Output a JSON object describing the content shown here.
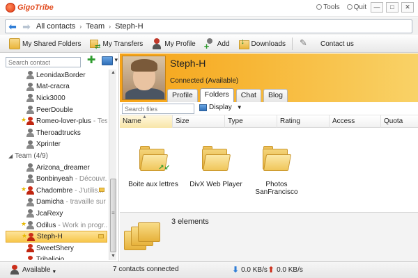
{
  "app": {
    "brand": "GigoTribe"
  },
  "window": {
    "tools_label": "Tools",
    "quit_label": "Quit"
  },
  "breadcrumb": [
    "All contacts",
    "Team",
    "Steph-H"
  ],
  "toolbar": {
    "buttons": [
      {
        "label": "My Shared Folders",
        "icon": "shared-folders-icon"
      },
      {
        "label": "My Transfers",
        "icon": "transfers-icon"
      },
      {
        "label": "My Profile",
        "icon": "profile-icon"
      },
      {
        "label": "Add",
        "icon": "add-contact-icon"
      },
      {
        "label": "Downloads",
        "icon": "downloads-icon"
      },
      {
        "label": "Contact us",
        "icon": "contact-us-icon"
      }
    ]
  },
  "sidebar": {
    "search_placeholder": "Search contact",
    "contacts_top": [
      {
        "name": "LeonidaxBorder",
        "status": "",
        "online": false,
        "star": false,
        "mail": false
      },
      {
        "name": "Mat-cracra",
        "status": "",
        "online": false,
        "star": false,
        "mail": false
      },
      {
        "name": "Nick3000",
        "status": "",
        "online": false,
        "star": false,
        "mail": false
      },
      {
        "name": "PeerDouble",
        "status": "",
        "online": false,
        "star": false,
        "mail": false
      },
      {
        "name": "Romeo-lover-plus",
        "status": "- Tes...",
        "online": true,
        "star": true,
        "mail": false
      },
      {
        "name": "Theroadtrucks",
        "status": "",
        "online": false,
        "star": false,
        "mail": false
      },
      {
        "name": "Xprinter",
        "status": "",
        "online": false,
        "star": false,
        "mail": false
      }
    ],
    "group": {
      "label": "Team (4/9)"
    },
    "contacts_team": [
      {
        "name": "Arizona_dreamer",
        "status": "",
        "online": false,
        "star": false,
        "mail": false
      },
      {
        "name": "Bonbinyeah",
        "status": "- Découvr...",
        "online": false,
        "star": false,
        "mail": false
      },
      {
        "name": "Chadombre",
        "status": "- J'utilis...",
        "online": true,
        "star": true,
        "mail": true
      },
      {
        "name": "Damicha",
        "status": "- travaille sur ...",
        "online": false,
        "star": false,
        "mail": false
      },
      {
        "name": "JcaRexy",
        "status": "",
        "online": false,
        "star": false,
        "mail": false
      },
      {
        "name": "Odilus",
        "status": "- Work in progr...",
        "online": false,
        "star": true,
        "mail": false
      },
      {
        "name": "Steph-H",
        "status": "",
        "online": true,
        "star": true,
        "mail": true,
        "selected": true
      },
      {
        "name": "SweetShery",
        "status": "",
        "online": true,
        "star": false,
        "mail": false
      },
      {
        "name": "Tribaljojo",
        "status": "",
        "online": true,
        "star": false,
        "mail": false
      }
    ]
  },
  "profile": {
    "name": "Steph-H",
    "status": "Connected (Available)",
    "tabs": [
      "Profile",
      "Folders",
      "Chat",
      "Blog"
    ],
    "active_tab": "Folders"
  },
  "files": {
    "search_placeholder": "Search files",
    "display_label": "Display",
    "columns": [
      "Name",
      "Size",
      "Type",
      "Rating",
      "Access",
      "Quota"
    ],
    "items": [
      {
        "name": "Boite aux lettres",
        "shared": true
      },
      {
        "name": "DivX Web Player",
        "shared": false
      },
      {
        "name": "Photos SanFrancisco",
        "shared": false
      }
    ],
    "count_label": "3 elements"
  },
  "statusbar": {
    "availability": "Available",
    "connected": "7 contacts connected",
    "down_rate": "0.0 KB/s",
    "up_rate": "0.0 KB/s"
  },
  "colors": {
    "accent": "#f6a317",
    "brand": "#e24b1e",
    "selection": "#f7c64a"
  }
}
